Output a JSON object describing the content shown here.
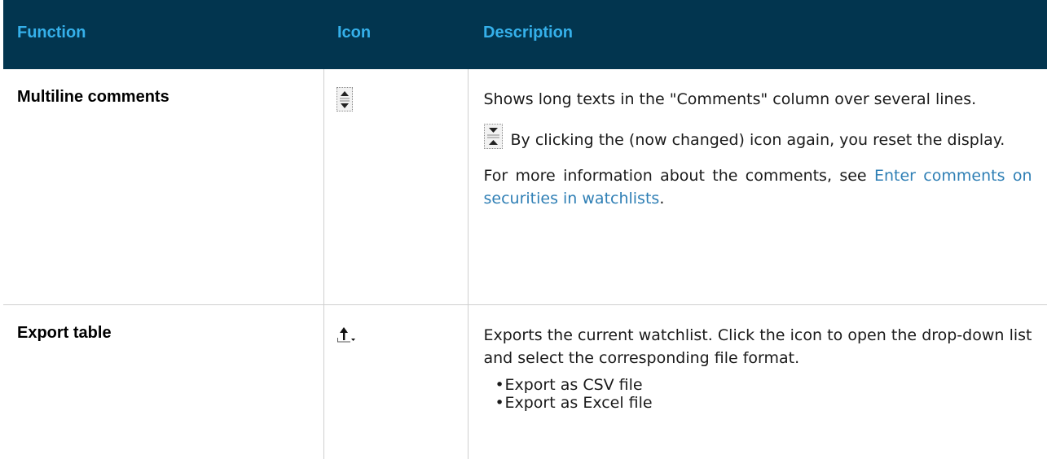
{
  "table": {
    "headers": {
      "function": "Function",
      "icon": "Icon",
      "description": "Description"
    },
    "rows": [
      {
        "function": "Multiline comments",
        "icon": "expand-rows-icon",
        "desc_p1": "Shows long texts in the \"Comments\" column over several lines.",
        "desc_p2_icon": "collapse-rows-icon",
        "desc_p2": "By clicking the (now changed) icon again, you reset the display.",
        "desc_p3_prefix": "For more information about the comments, see ",
        "desc_p3_link": "Enter comments on securities in watchlists",
        "desc_p3_suffix": "."
      },
      {
        "function": "Export table",
        "icon": "export-icon",
        "desc_p1": "Exports the current watchlist. Click the icon to open the drop-down list and select the corresponding file format.",
        "bullets": [
          "Export as CSV file",
          "Export as Excel file"
        ]
      }
    ]
  },
  "colors": {
    "header_bg": "#02354f",
    "header_text": "#35b0ea",
    "link": "#2f7fb5",
    "border": "#cfcfcf"
  }
}
